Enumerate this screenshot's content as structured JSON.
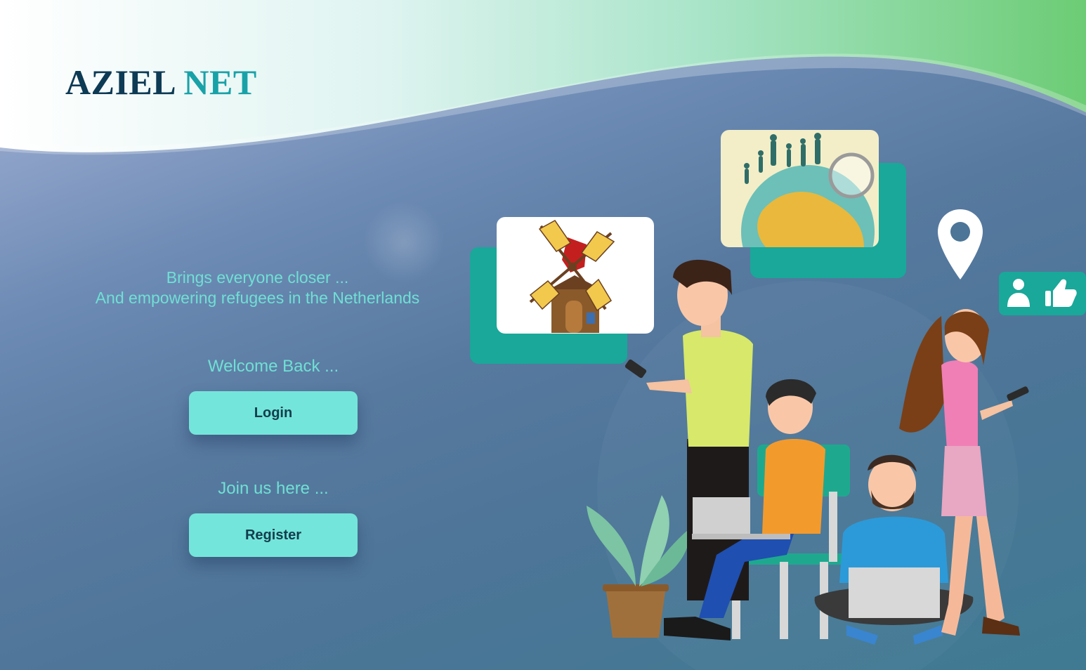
{
  "brand": {
    "part1": "AZIEL",
    "part2": "NET",
    "color_dark": "#0d3a55",
    "color_accent": "#18a2a8"
  },
  "hero": {
    "line1": "Brings everyone closer ...",
    "line2": "And empowering refugees in the Netherlands"
  },
  "login": {
    "caption": "Welcome Back ...",
    "button_label": "Login"
  },
  "register": {
    "caption": "Join us here ...",
    "button_label": "Register"
  },
  "illustration": {
    "icons": [
      "location-pin-icon",
      "user-icon",
      "thumbs-up-icon",
      "windmill-image",
      "world-refugees-image"
    ]
  },
  "colors": {
    "accent_teal": "#74e5da",
    "text_teal": "#6fe0d4",
    "card_teal": "#19a899"
  }
}
